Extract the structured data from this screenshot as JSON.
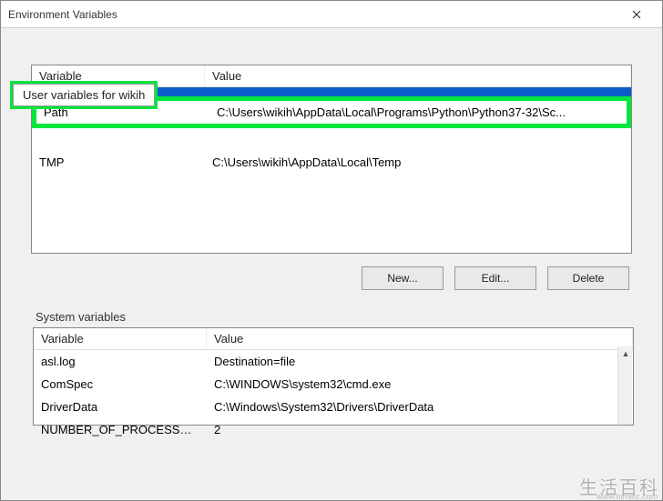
{
  "window": {
    "title": "Environment Variables"
  },
  "user_section": {
    "label": "User variables for wikih",
    "columns": {
      "var": "Variable",
      "val": "Value"
    },
    "rows": {
      "selected": {
        "name": "",
        "value": ""
      },
      "path": {
        "name": "Path",
        "value": "C:\\Users\\wikih\\AppData\\Local\\Programs\\Python\\Python37-32\\Sc..."
      },
      "tmp": {
        "name": "TMP",
        "value": "C:\\Users\\wikih\\AppData\\Local\\Temp"
      }
    },
    "buttons": {
      "new": "New...",
      "edit": "Edit...",
      "delete": "Delete"
    }
  },
  "system_section": {
    "label": "System variables",
    "columns": {
      "var": "Variable",
      "val": "Value"
    },
    "rows": [
      {
        "name": "asl.log",
        "value": "Destination=file"
      },
      {
        "name": "ComSpec",
        "value": "C:\\WINDOWS\\system32\\cmd.exe"
      },
      {
        "name": "DriverData",
        "value": "C:\\Windows\\System32\\Drivers\\DriverData"
      },
      {
        "name": "NUMBER_OF_PROCESSORS",
        "value": "2"
      }
    ]
  },
  "watermark": {
    "text": "生活百科",
    "url": "www.bimeiz.com"
  }
}
